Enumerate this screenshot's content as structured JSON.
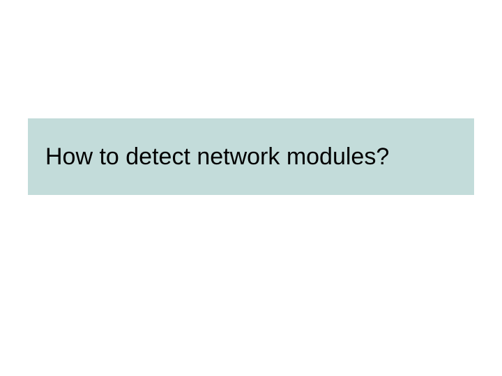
{
  "slide": {
    "title": "How to detect network modules?"
  }
}
